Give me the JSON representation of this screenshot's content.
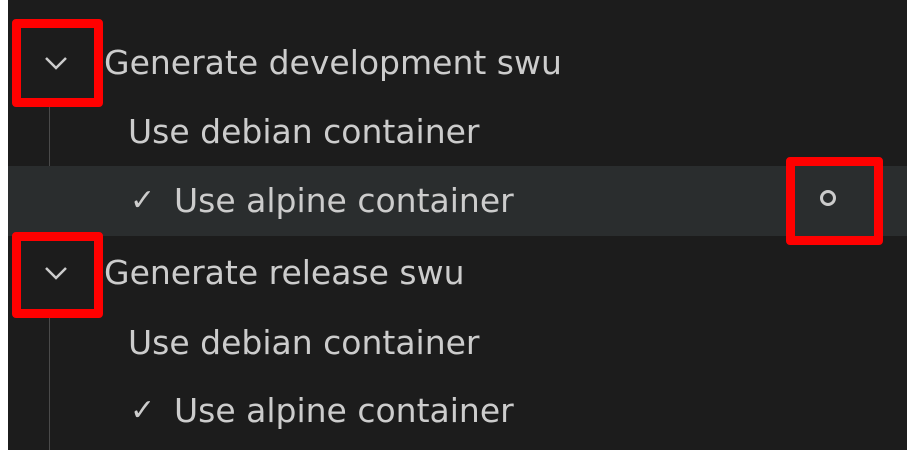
{
  "tree": {
    "partial_top_label": "' ' ' '",
    "groups": [
      {
        "label": "Generate development swu",
        "expanded": true,
        "chevron_icon": "chevron-down-icon",
        "children": [
          {
            "label": "Use debian container",
            "checked": false
          },
          {
            "label": "Use alpine container",
            "checked": true,
            "check_mark": "✓",
            "selected": true,
            "status_icon": "circle-outline-icon"
          }
        ]
      },
      {
        "label": "Generate release swu",
        "expanded": true,
        "chevron_icon": "chevron-down-icon",
        "children": [
          {
            "label": "Use debian container",
            "checked": false
          },
          {
            "label": "Use alpine container",
            "checked": true,
            "check_mark": "✓"
          }
        ]
      }
    ]
  },
  "colors": {
    "background": "#1c1c1c",
    "selected_row": "#2a2d2e",
    "text": "#cccccc",
    "highlight": "#ff0000"
  }
}
